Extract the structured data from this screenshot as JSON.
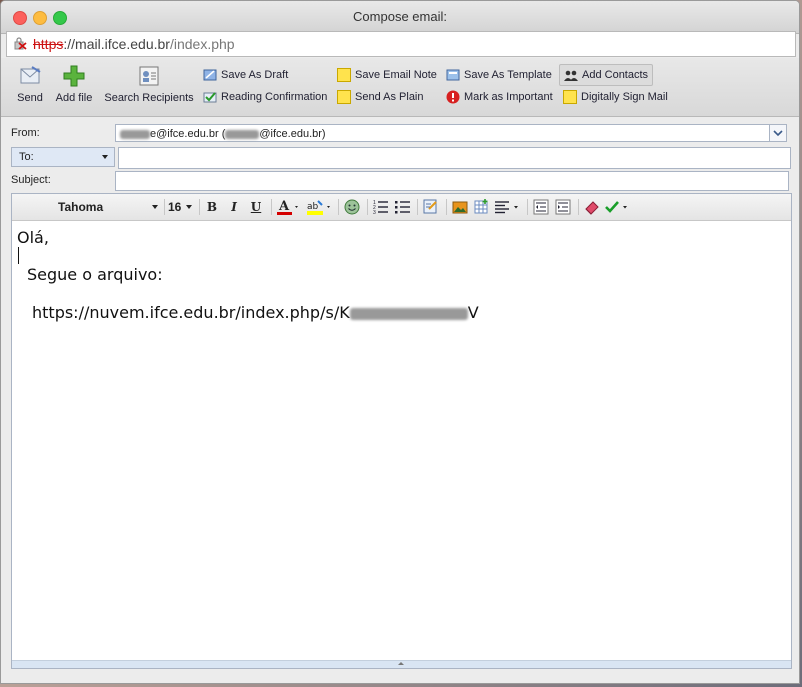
{
  "window": {
    "title": "Compose email:"
  },
  "urlbar": {
    "scheme": "https",
    "rest_pre": "://mail.ifce.edu.br",
    "path": "/index.php"
  },
  "toolbar": {
    "send": "Send",
    "add_file": "Add file",
    "search_recipients": "Search Recipients",
    "save_as_draft": "Save As Draft",
    "reading_confirmation": "Reading Confirmation",
    "save_email_note": "Save Email Note",
    "send_as_plain": "Send As Plain",
    "save_as_template": "Save As Template",
    "mark_as_important": "Mark as Important",
    "add_contacts": "Add Contacts",
    "digitally_sign_mail": "Digitally Sign Mail"
  },
  "fields": {
    "from_label": "From:",
    "from_value_mid": "e@ifce.edu.br (",
    "from_value_end": "@ifce.edu.br)",
    "to_label": "To:",
    "subject_label": "Subject:"
  },
  "editor": {
    "font_family": "Tahoma",
    "font_size": "16",
    "bold": "B",
    "italic": "I",
    "underline": "U",
    "body_line1": "Olá,",
    "body_line2": "Segue o arquivo:",
    "body_line3": "https://nuvem.ifce.edu.br/index.php/s/K",
    "body_line3_tail": "V"
  },
  "colors": {
    "text_color_bar": "#d40000",
    "highlight_bar": "#ffff00",
    "check": "#1a9e2a"
  }
}
